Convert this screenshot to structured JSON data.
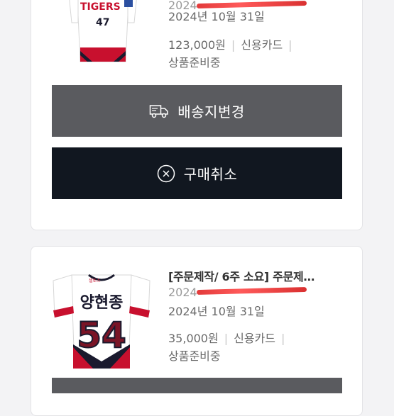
{
  "orders": [
    {
      "jersey_text": "TIGERS",
      "jersey_number": "47",
      "date_partial": "2024",
      "date": "2024년 10월 31일",
      "price": "123,000원",
      "payment": "신용카드",
      "status": "상품준비중"
    },
    {
      "title": "[주문제작/ 6주 소요] 주문제…",
      "jersey_tag": "셀토스",
      "jersey_name": "양현종",
      "jersey_number": "54",
      "date_partial": "2024",
      "date": "2024년 10월 31일",
      "price": "35,000원",
      "payment": "신용카드",
      "status": "상품준비중"
    }
  ],
  "buttons": {
    "change_address": "배송지변경",
    "cancel_order": "구매취소"
  },
  "colors": {
    "button_gray": "#5a5b5f",
    "button_dark": "#111720",
    "redaction": "#e23a3a",
    "jersey_red": "#c8102e"
  },
  "icons": {
    "change_address": "delivery-truck-icon",
    "cancel_order": "circle-x-icon"
  }
}
